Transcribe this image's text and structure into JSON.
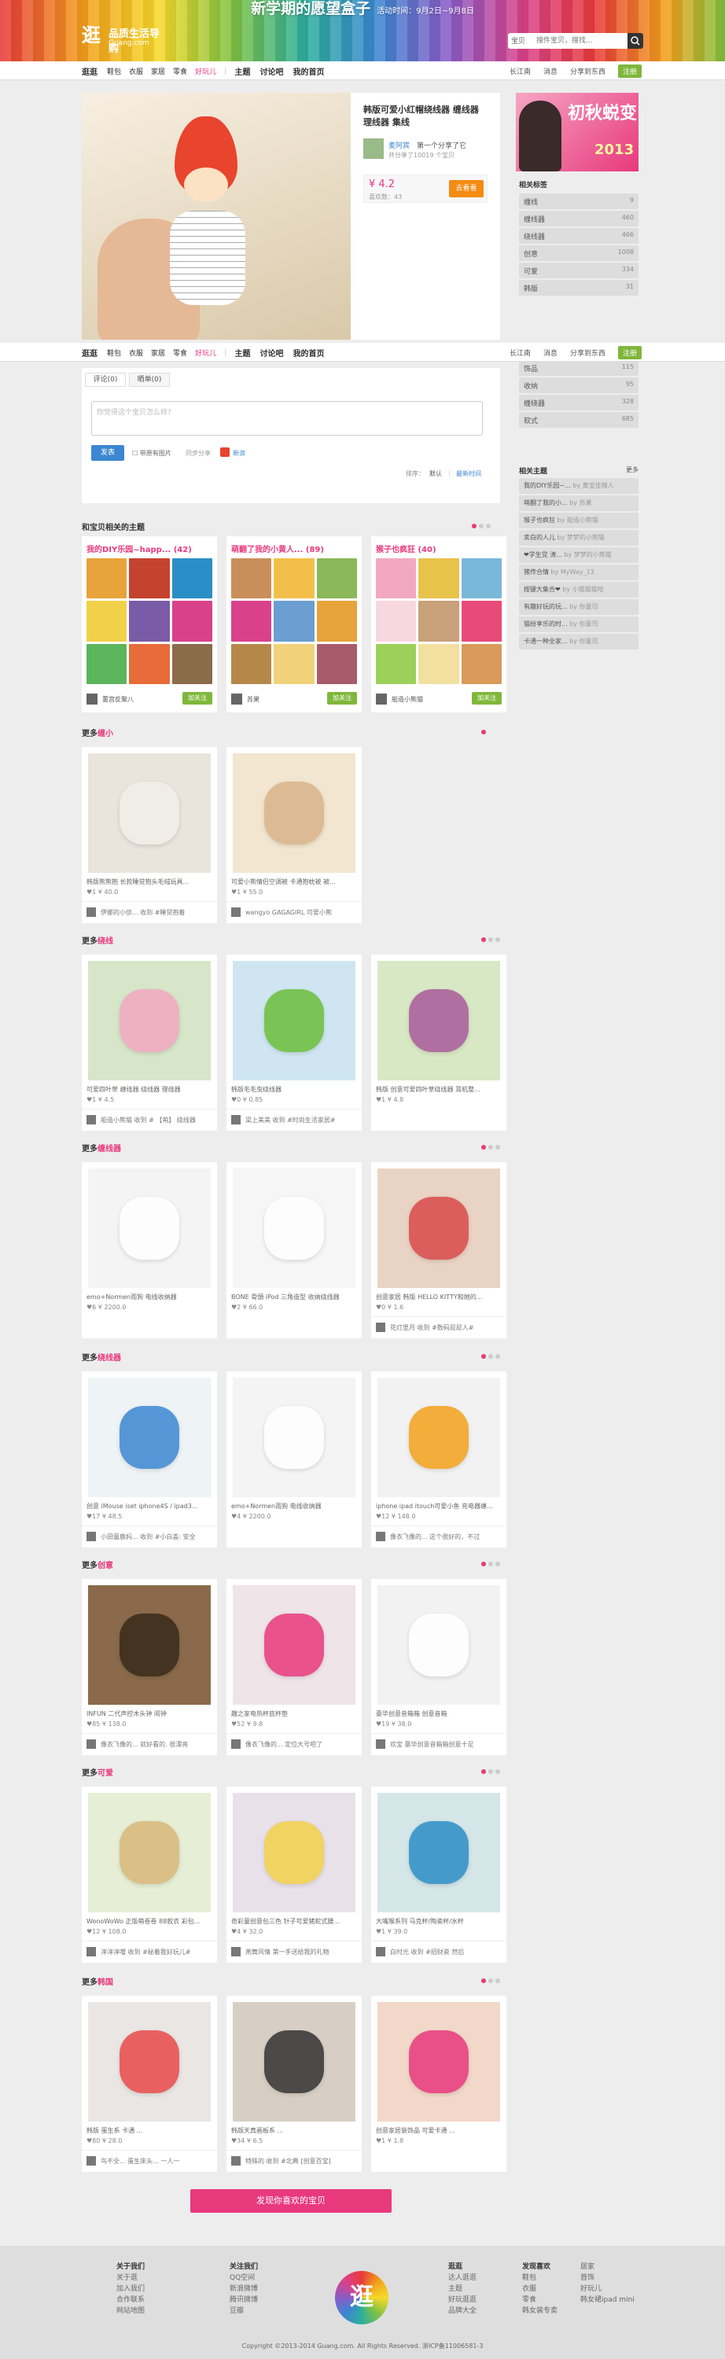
{
  "banner": {
    "promo": "新学期的愿望盒子",
    "promo_date": "活动时间：9月2日~9月8日"
  },
  "logo": {
    "glyph": "逛",
    "name": "品质生活导购",
    "domain": "Guang.com"
  },
  "search": {
    "scope": "宝贝",
    "placeholder": "搜件宝贝，搜找..."
  },
  "nav": {
    "items": [
      "逛逛",
      "鞋包",
      "衣服",
      "家居",
      "零食",
      "好玩儿",
      "主题",
      "讨论吧",
      "我的首页"
    ],
    "right": [
      "长江南",
      "消息",
      "分享到东西",
      "注册"
    ]
  },
  "product": {
    "title": "韩版可爱小红帽绕线器 缠线器 理线器 集线",
    "user": "麦阿宾",
    "user_note": "第一个分享了它",
    "user_stats": "共分享了10019 个宝贝",
    "price": "¥ 4.2",
    "likes": "喜欢数：43",
    "go": "去看看"
  },
  "sidebar": {
    "ad_title": "初秋蜕变",
    "ad_year": "2013",
    "tags_title": "相关标签",
    "tags": [
      [
        "缠线",
        9
      ],
      [
        "缠线器",
        460
      ],
      [
        "绕线器",
        466
      ],
      [
        "创意",
        1008
      ],
      [
        "可爱",
        334
      ],
      [
        "韩版",
        31
      ],
      [
        "饰品",
        115
      ],
      [
        "收纳",
        95
      ],
      [
        "缠绕器",
        328
      ],
      [
        "软式",
        685
      ]
    ],
    "themes_title": "相关主题",
    "themes_more": "更多",
    "themes": [
      [
        "我的DIY乐园~...",
        "by 黄宝佳辣人"
      ],
      [
        "萌翻了我的小...",
        "by 苏果"
      ],
      [
        "猴子也疯狂",
        "by 船造小熊猫"
      ],
      [
        "卖白的人儿",
        "by 梦梦的小熊猫"
      ],
      [
        "❤学生党 涛...",
        "by 梦梦的小熊猫"
      ],
      [
        "猪传合情",
        "by MyWay_13"
      ],
      [
        "按键大集合❤",
        "by 小猫猫猫哈"
      ],
      [
        "有趣好玩的玩...",
        "by 你童司"
      ],
      [
        "猫纷享乐的时...",
        "by 你童司"
      ],
      [
        "卡通一种全家...",
        "by 你童司"
      ]
    ]
  },
  "comment": {
    "tabs": [
      "评论(0)",
      "晒单(0)"
    ],
    "placeholder": "你觉得这个宝贝怎么样?",
    "send": "发表",
    "with_img": "带原有图片",
    "sync": "同步分享",
    "weibo": "新浪",
    "sort": "排序：",
    "sort_default": "默认",
    "sort_new": "最新时间"
  },
  "theme_section": {
    "title": "和宝贝相关的主题"
  },
  "theme_cards": [
    {
      "title": "我的DIY乐园~happ... (42)",
      "user": "董宫反聚八",
      "follow": "加关注"
    },
    {
      "title": "萌翻了我的小黄人... (89)",
      "user": "苏果",
      "follow": "加关注"
    },
    {
      "title": "猴子也疯狂 (40)",
      "user": "船造小熊猫",
      "follow": "加关注"
    }
  ],
  "sections": [
    {
      "prefix": "更多",
      "kw": "缠小",
      "items": [
        {
          "desc": "韩版熊熊抱 长款睡觉抱头毛绒玩具...",
          "stats": "♥1  ¥ 40.0",
          "user": "伊娜的小侦... 收到 #睡觉抱着"
        },
        {
          "desc": "可爱小熊情侣空调被 卡通抱枕被 被...",
          "stats": "♥1  ¥ 55.0",
          "user": "wangyo  GAGAGIRL 可爱小熊"
        }
      ]
    },
    {
      "prefix": "更多",
      "kw": "绕线",
      "items": [
        {
          "desc": "可爱四叶草 缠线器 绕线器 理线器",
          "stats": "♥1  ¥ 4.5",
          "user": "船造小熊猫  收到 # 【萌】 绕线器"
        },
        {
          "desc": "韩版毛毛虫绕线器",
          "stats": "♥0  ¥ 0.85",
          "user": "梁上美美  收到 #时尚生活家居#"
        },
        {
          "desc": "韩版 创意可爱四叶草绕线器 耳机整...",
          "stats": "♥1  ¥ 4.8",
          "user": ""
        }
      ]
    },
    {
      "prefix": "更多",
      "kw": "缠线器",
      "items": [
        {
          "desc": "emo+Normen雨狗 电线收纳器",
          "stats": "♥6  ¥ 2200.0",
          "user": ""
        },
        {
          "desc": "BONE 骨頭 iPod 三角造型 收纳绕线器",
          "stats": "♥2  ¥ 66.0",
          "user": ""
        },
        {
          "desc": "创意家居 韩版 HELLO KITTY和她的...",
          "stats": "♥0  ¥ 1.6",
          "user": "花灯里月  收到 #数码屁屁人#"
        }
      ]
    },
    {
      "prefix": "更多",
      "kw": "绕线器",
      "items": [
        {
          "desc": "创意 iMouse iset iphone4S / ipad3...",
          "stats": "♥17  ¥ 48.5",
          "user": "小田童鹿妈...  收到 #小白盖: 安全"
        },
        {
          "desc": "emo+Normen雨狗 电线收纳器",
          "stats": "♥4  ¥ 2200.0",
          "user": ""
        },
        {
          "desc": "iphone ipad itouch可爱小鱼 充电器缠...",
          "stats": "♥12  ¥ 148.0",
          "user": "像衣飞像的...  这个很好的，不过"
        }
      ]
    },
    {
      "prefix": "更多",
      "kw": "创意",
      "items": [
        {
          "desc": "INFUN 二代声控木头钟 闹钟",
          "stats": "♥85  ¥ 138.0",
          "user": "像衣飞像的...  就好看的. 很漂亮"
        },
        {
          "desc": "趣之家电热杯底杯垫",
          "stats": "♥52  ¥ 9.8",
          "user": "像衣飞像的...  定位大号吧了"
        },
        {
          "desc": "豪华创意音箱箱 创意音箱",
          "stats": "♥19  ¥ 38.0",
          "user": "欢宝  豪华创意音箱箱创意十足"
        }
      ]
    },
    {
      "prefix": "更多",
      "kw": "可爱",
      "items": [
        {
          "desc": "WonoWoWo 正版萌卷卷 88款衣 彩包...",
          "stats": "♥12  ¥ 108.0",
          "user": "淳淳淳噹  收到 #秘着我好玩儿#"
        },
        {
          "desc": "奇彩童创意包三色 针子可爱猪蛇式腰...",
          "stats": "♥4  ¥ 32.0",
          "user": "燕舞风情  第一手送给我的礼物"
        },
        {
          "desc": "大嘴猴系列 马克杯/陶瓷杯/水杯",
          "stats": "♥1  ¥ 39.0",
          "user": "白时光  收到 #招财瓷 然后"
        }
      ]
    },
    {
      "prefix": "更多",
      "kw": "韩国",
      "items": [
        {
          "desc": "韩版 蛋生系 卡通 ...",
          "stats": "♥80  ¥ 28.0",
          "user": "鸟不全...  蛋生床头... 一人一"
        },
        {
          "desc": "韩版天真画板系 ...",
          "stats": "♥34  ¥ 6.5",
          "user": "特殊的  收到 #北典 [创意百宝]"
        },
        {
          "desc": "创意家居装饰品 可爱卡通 ...",
          "stats": "♥1  ¥ 1.8",
          "user": ""
        }
      ]
    }
  ],
  "discover": "发现你喜欢的宝贝",
  "footer": {
    "cols": [
      {
        "h": "关于我们",
        "items": [
          "关于逛",
          "加入我们",
          "合作联系",
          "网站地图"
        ]
      },
      {
        "h": "关注我们",
        "items": [
          "QQ空间",
          "新浪微博",
          "腾讯微博",
          "豆瓣"
        ]
      },
      {
        "h": "逛逛",
        "items": [
          "达人逛逛",
          "主题",
          "好玩逛逛",
          "品牌大全"
        ]
      },
      {
        "h": "发现喜欢",
        "items": [
          "鞋包",
          "衣服",
          "零食",
          "韩女装专卖"
        ]
      },
      {
        "h": "",
        "items": [
          "居家",
          "首饰",
          "好玩儿",
          "韩女裙ipad mini"
        ]
      }
    ],
    "logo": "逛",
    "copyright": "Copyright ©2013-2014 Guang.com. All Rights Reserved. 浙ICP备11006581-3"
  },
  "colors": {
    "accent": "#e8397d",
    "link": "#3b87d1",
    "green": "#7fb73b",
    "orange": "#f48b13"
  }
}
